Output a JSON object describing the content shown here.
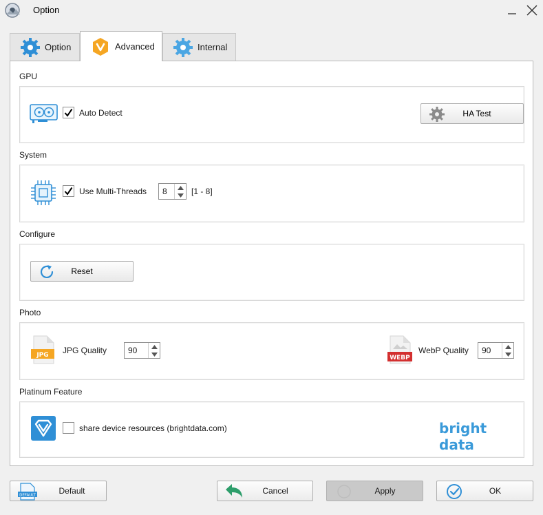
{
  "window": {
    "title": "Option",
    "app_icon": "app-logo-icon",
    "minimize_icon": "minimize-icon",
    "close_icon": "close-icon"
  },
  "tabs": [
    {
      "label": "Option",
      "icon": "gear-icon",
      "active": false
    },
    {
      "label": "Advanced",
      "icon": "advanced-badge-icon",
      "active": true
    },
    {
      "label": "Internal",
      "icon": "gear-icon",
      "active": false
    }
  ],
  "gpu": {
    "section_label": "GPU",
    "auto_detect_label": "Auto Detect",
    "auto_detect_checked": true,
    "ha_test_label": "HA Test",
    "icon": "graphics-card-icon"
  },
  "system": {
    "section_label": "System",
    "multithread_label": "Use Multi-Threads",
    "multithread_checked": true,
    "threads_value": "8",
    "threads_range": "[1 - 8]",
    "icon": "cpu-chip-icon"
  },
  "configure": {
    "section_label": "Configure",
    "reset_label": "Reset",
    "icon": "refresh-icon"
  },
  "photo": {
    "section_label": "Photo",
    "jpg_quality_label": "JPG Quality",
    "jpg_quality_value": "90",
    "jpg_badge": "JPG",
    "webp_quality_label": "WebP Quality",
    "webp_quality_value": "90",
    "webp_badge": "WEBP"
  },
  "platinum": {
    "section_label": "Platinum Feature",
    "share_label": "share device resources (brightdata.com)",
    "share_checked": false,
    "brand_logo_text": "bright data"
  },
  "footer": {
    "default_label": "Default",
    "default_badge": "DEFAULT",
    "cancel_label": "Cancel",
    "apply_label": "Apply",
    "ok_label": "OK"
  },
  "colors": {
    "accent_blue": "#2f8fd6",
    "advanced_orange": "#f5a623",
    "jpg_orange": "#f5a623",
    "webp_red": "#d32f2f",
    "cancel_green": "#2e9e6b",
    "brand_blue": "#3a9ad9"
  }
}
